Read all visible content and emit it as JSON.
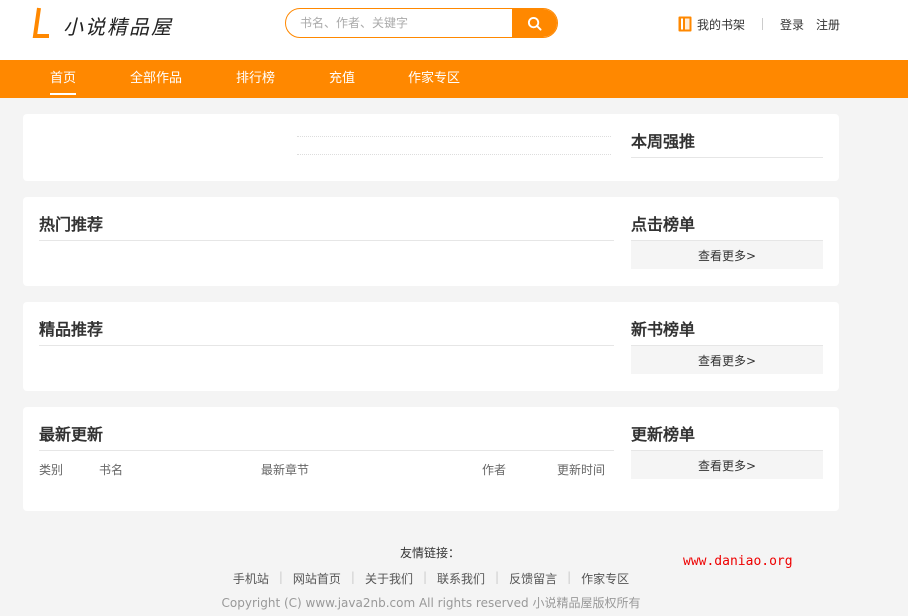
{
  "header": {
    "logo_text": "小说精品屋",
    "search_placeholder": "书名、作者、关键字",
    "shelf_label": "我的书架",
    "login_label": "登录",
    "register_label": "注册"
  },
  "nav": {
    "items": [
      {
        "label": "首页"
      },
      {
        "label": "全部作品"
      },
      {
        "label": "排行榜"
      },
      {
        "label": "充值"
      },
      {
        "label": "作家专区"
      }
    ]
  },
  "sections": {
    "weekly_title": "本周强推",
    "hot_title": "热门推荐",
    "click_rank_title": "点击榜单",
    "fine_title": "精品推荐",
    "new_rank_title": "新书榜单",
    "latest_title": "最新更新",
    "update_rank_title": "更新榜单",
    "more_label": "查看更多>"
  },
  "latest_table": {
    "headers": [
      "类别",
      "书名",
      "最新章节",
      "作者",
      "更新时间"
    ]
  },
  "footer": {
    "links_title": "友情链接：",
    "links": [
      "手机站",
      "网站首页",
      "关于我们",
      "联系我们",
      "反馈留言",
      "作家专区"
    ],
    "copyright": "Copyright (C) www.java2nb.com All rights reserved   小说精品屋版权所有"
  },
  "watermark": "www.daniao.org",
  "colors": {
    "accent": "#ff8800",
    "watermark": "#ee0000"
  }
}
